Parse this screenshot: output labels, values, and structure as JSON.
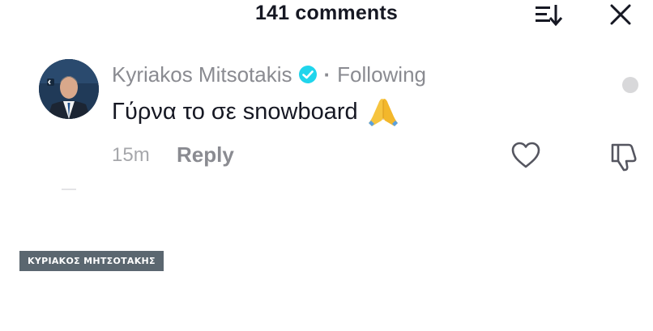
{
  "header": {
    "title": "141 comments",
    "sort_icon": "sort-descending-icon",
    "close_icon": "close-icon"
  },
  "comment": {
    "author": "Kyriakos Mitsotakis",
    "verified": true,
    "separator": "·",
    "relationship": "Following",
    "text": "Γύρνα το σε snowboard",
    "emoji": "folded-hands-icon",
    "time": "15m",
    "reply_label": "Reply",
    "like_icon": "heart-icon",
    "dislike_icon": "thumbs-down-icon"
  },
  "caption": {
    "label": "ΚΥΡΙΑΚΟΣ ΜΗΤΣΟΤΑΚΗΣ"
  },
  "colors": {
    "text_primary": "#161823",
    "text_secondary": "#8a8b91",
    "verified_blue": "#20d5ec",
    "caption_bg": "#5b6770"
  }
}
